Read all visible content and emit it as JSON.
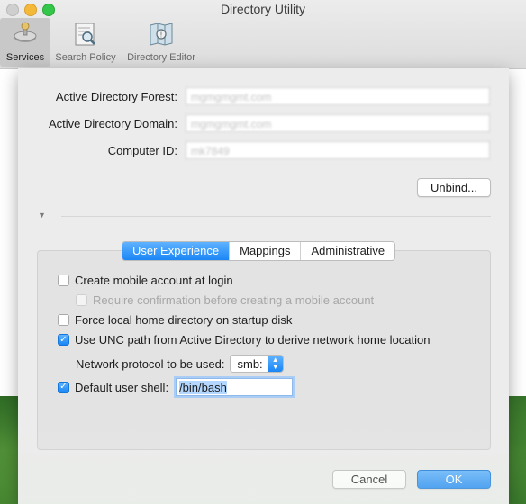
{
  "window": {
    "title": "Directory Utility"
  },
  "toolbar": {
    "services": "Services",
    "search_policy": "Search Policy",
    "directory_editor": "Directory Editor"
  },
  "form": {
    "forest_label": "Active Directory Forest:",
    "forest_value": "mgmgmgmt.com",
    "domain_label": "Active Directory Domain:",
    "domain_value": "mgmgmgmt.com",
    "computer_label": "Computer ID:",
    "computer_value": "mk7849"
  },
  "buttons": {
    "unbind": "Unbind...",
    "cancel": "Cancel",
    "ok": "OK"
  },
  "tabs": [
    "User Experience",
    "Mappings",
    "Administrative"
  ],
  "options": {
    "mobile_account": {
      "label": "Create mobile account at login",
      "checked": false
    },
    "require_confirmation": {
      "label": "Require confirmation before creating a mobile account",
      "checked": false,
      "enabled": false
    },
    "force_local_home": {
      "label": "Force local home directory on startup disk",
      "checked": false
    },
    "use_unc_path": {
      "label": "Use UNC path from Active Directory to derive network home location",
      "checked": true
    },
    "network_protocol_label": "Network protocol to be used:",
    "network_protocol_value": "smb:",
    "default_shell": {
      "label": "Default user shell:",
      "checked": true,
      "value": "/bin/bash"
    }
  },
  "colors": {
    "accent": "#1a86f5",
    "sheet": "#ececec",
    "panel": "#e3e3e3"
  },
  "icons": {
    "services": "services-icon",
    "search_policy": "search-policy-icon",
    "directory_editor": "directory-editor-icon"
  }
}
